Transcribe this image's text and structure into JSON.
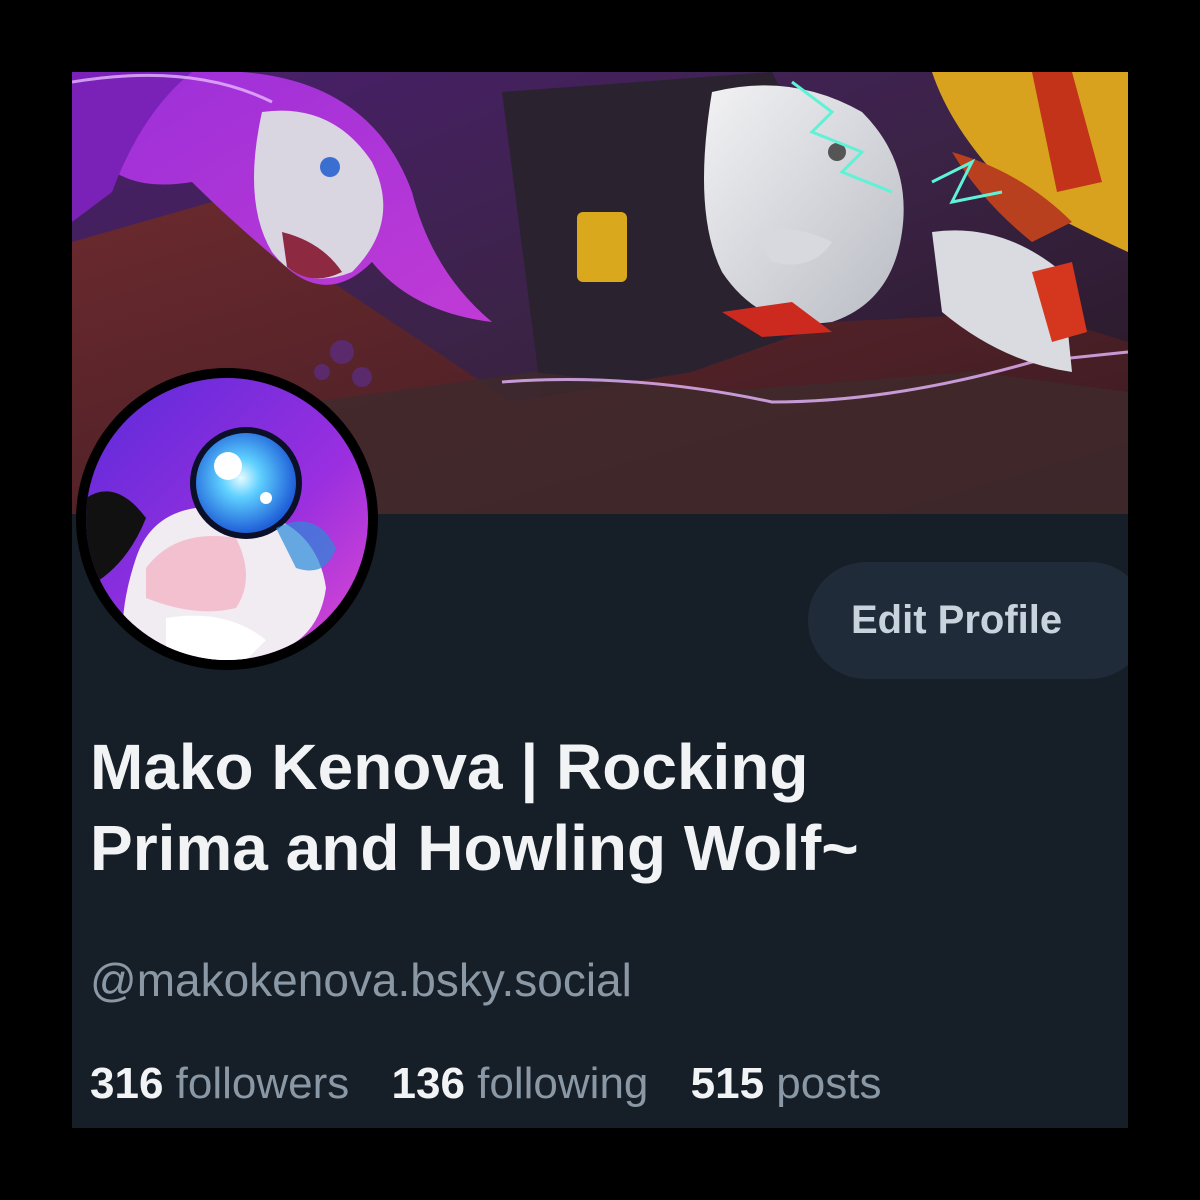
{
  "colors": {
    "page_background": "#000000",
    "card_background": "#161e27",
    "button_background": "#1f2b38",
    "button_text": "#c8d3de",
    "name_text": "#f1f3f5",
    "muted_text": "#8a98a6",
    "accent_purple": "#8a2be2"
  },
  "profile": {
    "banner_image": "banner-illustration",
    "avatar_image": "avatar-illustration",
    "edit_button_label": "Edit Profile",
    "display_name_line1": "Mako Kenova | Rocking",
    "display_name_line2": "Prima and Howling Wolf~",
    "handle": "@makokenova.bsky.social",
    "stats": {
      "followers_count": "316",
      "followers_label": "followers",
      "following_count": "136",
      "following_label": "following",
      "posts_count": "515",
      "posts_label": "posts"
    }
  }
}
